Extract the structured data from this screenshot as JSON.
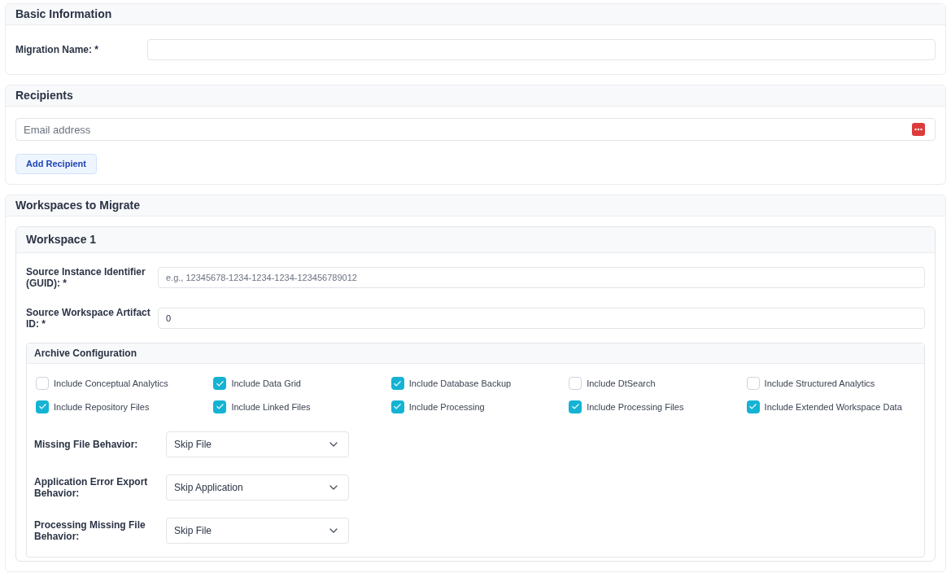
{
  "basic_information": {
    "title": "Basic Information",
    "migration_name": {
      "label": "Migration Name: *"
    }
  },
  "recipients": {
    "title": "Recipients",
    "email": {
      "placeholder": "Email address"
    },
    "add_button": "Add Recipient"
  },
  "workspaces": {
    "title": "Workspaces to Migrate",
    "items": [
      {
        "title": "Workspace 1",
        "fields": [
          {
            "label": "Source Instance Identifier (GUID): *",
            "placeholder": "e.g., 12345678-1234-1234-1234-123456789012"
          },
          {
            "label": "Source Workspace Artifact ID: *",
            "value": "0"
          }
        ],
        "archive": {
          "title": "Archive Configuration",
          "options": [
            {
              "label": "Include Conceptual Analytics",
              "checked": false
            },
            {
              "label": "Include Data Grid",
              "checked": true
            },
            {
              "label": "Include Database Backup",
              "checked": true
            },
            {
              "label": "Include DtSearch",
              "checked": false
            },
            {
              "label": "Include Structured Analytics",
              "checked": false
            },
            {
              "label": "Include Repository Files",
              "checked": true
            },
            {
              "label": "Include Linked Files",
              "checked": true
            },
            {
              "label": "Include Processing",
              "checked": true
            },
            {
              "label": "Include Processing Files",
              "checked": true
            },
            {
              "label": "Include Extended Workspace Data",
              "checked": true
            }
          ],
          "selects": [
            {
              "label": "Missing File Behavior:",
              "value": "Skip File"
            },
            {
              "label": "Application Error Export Behavior:",
              "value": "Skip Application"
            },
            {
              "label": "Processing Missing File Behavior:",
              "value": "Skip File"
            }
          ]
        }
      }
    ]
  }
}
